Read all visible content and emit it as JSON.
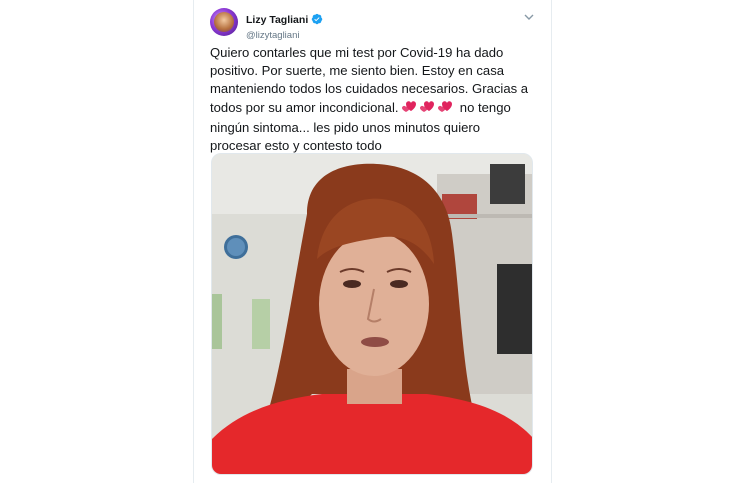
{
  "tweet": {
    "display_name": "Lizy Tagliani",
    "handle": "@lizytagliani",
    "text_before_hearts": "Quiero contarles que mi test por Covid-19 ha dado positivo. Por suerte, me siento bien. Estoy en casa manteniendo todos los cuidados necesarios. Gracias a todos por su amor incondicional.",
    "text_after_hearts": "no tengo ningún sintoma... les pido unos minutos quiero procesar esto y contesto todo",
    "emoji": "heart-emoji x3",
    "media_description": "selfie-photo"
  },
  "colors": {
    "verified_blue": "#1da1f2",
    "text": "#14171a",
    "secondary_text": "#657786",
    "heart_red": "#e0245e",
    "shirt_red": "#e5282b"
  },
  "icons": {
    "verified": "verified-badge-icon",
    "menu": "chevron-down-icon"
  }
}
